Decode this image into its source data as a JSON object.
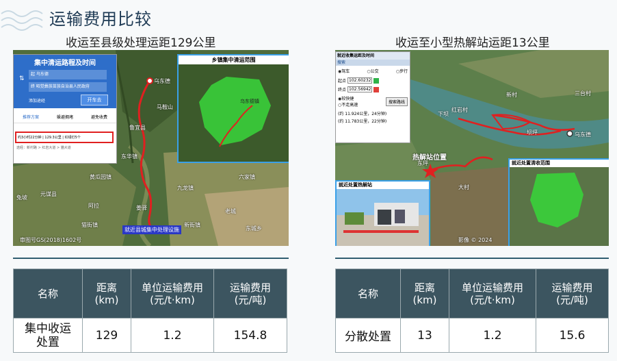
{
  "page": {
    "title": "运输费用比较",
    "left_subtitle": "收运至县级处理运距129公里",
    "right_subtitle": "收运至小型热解站运距13公里"
  },
  "left_map": {
    "route_panel": {
      "title": "集中清运路程及时间",
      "start": "起 乌东德",
      "end": "终 昭觉彝族苗族自治县人民政府",
      "add_waypoint": "添加途经",
      "go_button": "开车去",
      "tabs": [
        "推荐方案",
        "躲避拥堵",
        "避免收费"
      ],
      "result": "约3小时22分钟 | 129.3公里 | 红绿灯5个",
      "via": "途经：新村路 > 红岩大道 > 猫大道"
    },
    "inset_title": "乡镇集中清运范围",
    "inset_place": "乌东德镇",
    "labels": [
      "乌东德",
      "鲁宜县",
      "元谋县",
      "马鞍山",
      "东华镇",
      "黄瓜园镇",
      "九龙镇",
      "六家镇",
      "兔坡",
      "猫街镇",
      "新街镇",
      "姜驿",
      "阿拉",
      "老城",
      "东城乡"
    ],
    "bottom_label": "就近县城集中处理设施",
    "watermark": "审图号GS(2018)1602号"
  },
  "right_map": {
    "search_panel": {
      "title": "就近收集运距及时间",
      "header": "搜索",
      "modes": [
        "驾车",
        "公交",
        "步行"
      ],
      "start_label": "起点",
      "start_value": "102.60232",
      "end_label": "终点",
      "end_value": "102.56942",
      "options": [
        "较快捷",
        "不走高速"
      ],
      "search_button": "搜索路线",
      "result1": "(约 11.924公里，24分钟)",
      "result2": "(约 11.783公里，22分钟)"
    },
    "star_label": "热解站位置",
    "photo_title": "就近处置热解站",
    "inset_title": "就近处置清收范围",
    "labels": [
      "东坪",
      "红岩村",
      "乌东德",
      "三台村",
      "下坝",
      "大村",
      "新村",
      "坝坪"
    ],
    "watermark": "影像 © 2024"
  },
  "left_table": {
    "headers": [
      [
        "名称"
      ],
      [
        "距离",
        "(km)"
      ],
      [
        "单位运输费用",
        "(元/t·km)"
      ],
      [
        "运输费用",
        "(元/吨)"
      ]
    ],
    "row": [
      "集中收运处置",
      "129",
      "1.2",
      "154.8"
    ]
  },
  "right_table": {
    "headers": [
      [
        "名称"
      ],
      [
        "距离",
        "(km)"
      ],
      [
        "单位运输费用",
        "(元/t·km)"
      ],
      [
        "运输费用",
        "(元/吨)"
      ]
    ],
    "row": [
      "分散处置",
      "13",
      "1.2",
      "15.6"
    ]
  },
  "colors": {
    "title": "#1f3b55",
    "table_header": "#3c5560",
    "separator": "#2f5d70",
    "highlight": "#4aa8e0",
    "route": "#e02020",
    "area": "#39d23a"
  }
}
